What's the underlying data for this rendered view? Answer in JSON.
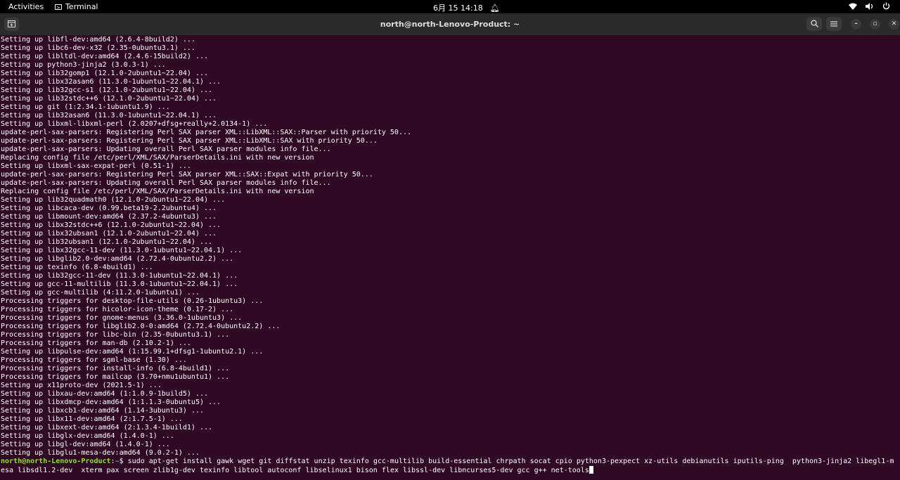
{
  "topbar": {
    "activities": "Activities",
    "app_name": "Terminal",
    "clock": "6月 15  14:18",
    "icons": [
      "network-icon",
      "volume-icon",
      "power-icon",
      "bell-icon",
      "terminal-app-icon"
    ]
  },
  "window": {
    "title": "north@north-Lenovo-Product: ~",
    "icons": [
      "new-tab-icon",
      "search-icon",
      "hamburger-menu-icon",
      "minimize-icon",
      "maximize-icon",
      "close-icon"
    ]
  },
  "colors": {
    "terminal_bg": "#300a24",
    "prompt_user": "#8ae234",
    "prompt_path": "#729fcf",
    "text": "#ffffff"
  },
  "terminal": {
    "lines": [
      "Setting up libfl-dev:amd64 (2.6.4-8build2) ...",
      "Setting up libc6-dev-x32 (2.35-0ubuntu3.1) ...",
      "Setting up libltdl-dev:amd64 (2.4.6-15build2) ...",
      "Setting up python3-jinja2 (3.0.3-1) ...",
      "Setting up lib32gomp1 (12.1.0-2ubuntu1~22.04) ...",
      "Setting up libx32asan6 (11.3.0-1ubuntu1~22.04.1) ...",
      "Setting up lib32gcc-s1 (12.1.0-2ubuntu1~22.04) ...",
      "Setting up lib32stdc++6 (12.1.0-2ubuntu1~22.04) ...",
      "Setting up git (1:2.34.1-1ubuntu1.9) ...",
      "Setting up lib32asan6 (11.3.0-1ubuntu1~22.04.1) ...",
      "Setting up libxml-libxml-perl (2.0207+dfsg+really+2.0134-1) ...",
      "update-perl-sax-parsers: Registering Perl SAX parser XML::LibXML::SAX::Parser with priority 50...",
      "update-perl-sax-parsers: Registering Perl SAX parser XML::LibXML::SAX with priority 50...",
      "update-perl-sax-parsers: Updating overall Perl SAX parser modules info file...",
      "Replacing config file /etc/perl/XML/SAX/ParserDetails.ini with new version",
      "Setting up libxml-sax-expat-perl (0.51-1) ...",
      "update-perl-sax-parsers: Registering Perl SAX parser XML::SAX::Expat with priority 50...",
      "update-perl-sax-parsers: Updating overall Perl SAX parser modules info file...",
      "Replacing config file /etc/perl/XML/SAX/ParserDetails.ini with new version",
      "Setting up lib32quadmath0 (12.1.0-2ubuntu1~22.04) ...",
      "Setting up libcaca-dev (0.99.beta19-2.2ubuntu4) ...",
      "Setting up libmount-dev:amd64 (2.37.2-4ubuntu3) ...",
      "Setting up libx32stdc++6 (12.1.0-2ubuntu1~22.04) ...",
      "Setting up libx32ubsan1 (12.1.0-2ubuntu1~22.04) ...",
      "Setting up lib32ubsan1 (12.1.0-2ubuntu1~22.04) ...",
      "Setting up libx32gcc-11-dev (11.3.0-1ubuntu1~22.04.1) ...",
      "Setting up libglib2.0-dev:amd64 (2.72.4-0ubuntu2.2) ...",
      "Setting up texinfo (6.8-4build1) ...",
      "Setting up lib32gcc-11-dev (11.3.0-1ubuntu1~22.04.1) ...",
      "Setting up gcc-11-multilib (11.3.0-1ubuntu1~22.04.1) ...",
      "Setting up gcc-multilib (4:11.2.0-1ubuntu1) ...",
      "Processing triggers for desktop-file-utils (0.26-1ubuntu3) ...",
      "Processing triggers for hicolor-icon-theme (0.17-2) ...",
      "Processing triggers for gnome-menus (3.36.0-1ubuntu3) ...",
      "Processing triggers for libglib2.0-0:amd64 (2.72.4-0ubuntu2.2) ...",
      "Processing triggers for libc-bin (2.35-0ubuntu3.1) ...",
      "Processing triggers for man-db (2.10.2-1) ...",
      "Setting up libpulse-dev:amd64 (1:15.99.1+dfsg1-1ubuntu2.1) ...",
      "Processing triggers for sgml-base (1.30) ...",
      "Processing triggers for install-info (6.8-4build1) ...",
      "Processing triggers for mailcap (3.70+nmu1ubuntu1) ...",
      "Setting up x11proto-dev (2021.5-1) ...",
      "Setting up libxau-dev:amd64 (1:1.0.9-1build5) ...",
      "Setting up libxdmcp-dev:amd64 (1:1.1.3-0ubuntu5) ...",
      "Setting up libxcb1-dev:amd64 (1.14-3ubuntu3) ...",
      "Setting up libx11-dev:amd64 (2:1.7.5-1) ...",
      "Setting up libxext-dev:amd64 (2:1.3.4-1build1) ...",
      "Setting up libglx-dev:amd64 (1.4.0-1) ...",
      "Setting up libgl-dev:amd64 (1.4.0-1) ...",
      "Setting up libglu1-mesa-dev:amd64 (9.0.2-1) ..."
    ],
    "prompt_user": "north@north-Lenovo-Product",
    "prompt_sep": ":",
    "prompt_path": "~",
    "prompt_symbol": "$ ",
    "command_line1": "sudo apt-get install gawk wget git diffstat unzip texinfo gcc-multilib build-essential chrpath socat cpio python3-pexpect xz-utils debianutils iputils-ping  python3-jinja2 libegl1-m",
    "command_line2": "esa libsdl1.2-dev  xterm pax screen zlib1g-dev texinfo libtool autoconf libselinux1 bison flex libssl-dev libncurses5-dev gcc g++ net-tools"
  }
}
